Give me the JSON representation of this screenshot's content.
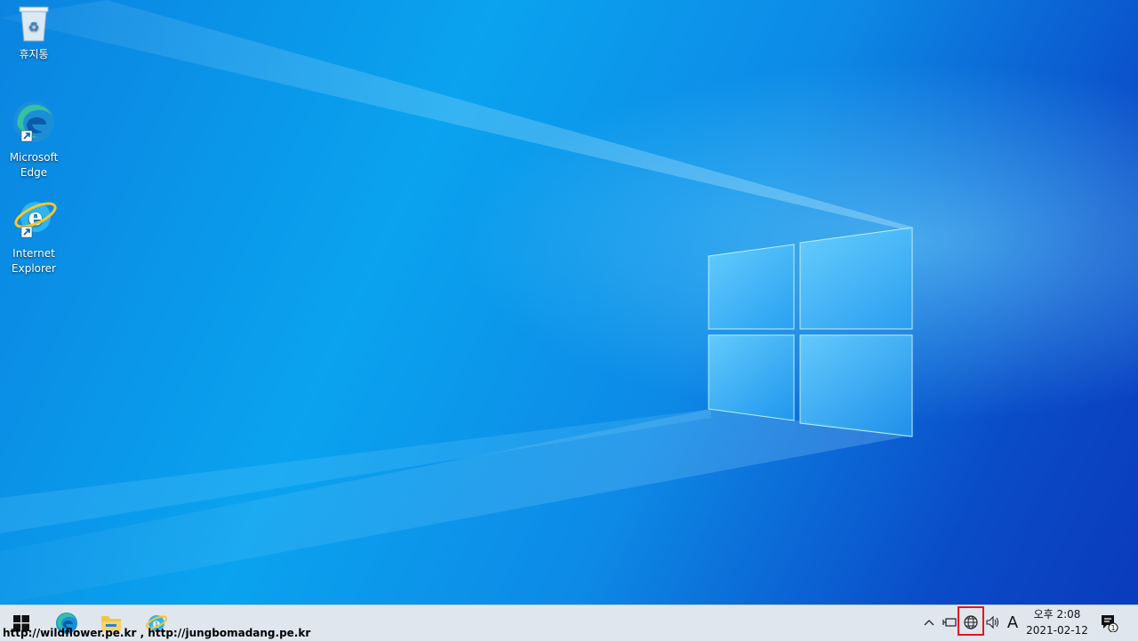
{
  "desktop": {
    "icons": [
      {
        "name": "recycle-bin",
        "label": "휴지통"
      },
      {
        "name": "microsoft-edge",
        "label_line1": "Microsoft",
        "label_line2": "Edge"
      },
      {
        "name": "internet-explorer",
        "label_line1": "Internet",
        "label_line2": "Explorer"
      }
    ]
  },
  "taskbar": {
    "watermark": "http://wildflower.pe.kr , http://jungbomadang.pe.kr",
    "pinned": [
      "start-icon",
      "edge-icon",
      "file-explorer-icon",
      "internet-explorer-icon"
    ],
    "tray": {
      "language": "A",
      "time": "오후 2:08",
      "date": "2021-02-12",
      "notification_count": "1"
    }
  },
  "colors": {
    "highlight": "#e81123",
    "taskbar": "#dfe6ee"
  }
}
